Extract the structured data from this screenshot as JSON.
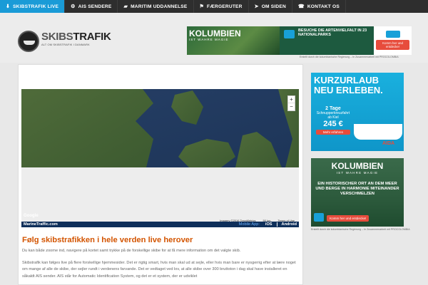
{
  "nav": {
    "items": [
      {
        "label": "SKIBSTRAFIK LIVE",
        "icon": "download-icon",
        "glyph": "⬇"
      },
      {
        "label": "AIS SENDERE",
        "icon": "gear-icon",
        "glyph": "⚙"
      },
      {
        "label": "MARITIM UDDANNELSE",
        "icon": "graduation-icon",
        "glyph": "▰"
      },
      {
        "label": "FÆRGERUTER",
        "icon": "flag-icon",
        "glyph": "⚑"
      },
      {
        "label": "OM SIDEN",
        "icon": "paper-plane-icon",
        "glyph": "➤"
      },
      {
        "label": "KONTAKT OS",
        "icon": "phone-icon",
        "glyph": "☎"
      }
    ]
  },
  "logo": {
    "main_a": "SKIBS",
    "main_b": "TRAFIK",
    "tagline": "ALT OM SKIBSTRAFIK I DANMARK"
  },
  "ad_top": {
    "headline": "KOLUMBIEN",
    "sub": "IST WAHRE MAGIE",
    "mid": "BESUCHE DIE ARTENVIELFALT IN 23 NATIONALPARKS",
    "cta": "Komm her und entdecke!",
    "credit": "Erstellt durch die kolumbianische Regierung – In Zusammenarbeit mit PROCOLOMBIA"
  },
  "map": {
    "zoom_in": "+",
    "zoom_out": "−",
    "google": "Google",
    "attribution": "Imagery ©2016 TerraMetrics",
    "scale": "50 km",
    "terms": "Terms of Use"
  },
  "marinetraffic": {
    "brand": "MarineTraffic.com",
    "mobile": "Mobile App:",
    "ios": "iOS",
    "android": "Android"
  },
  "content": {
    "title": "Følg skibstrafikken i hele verden live herover",
    "lead": "Du kan både zoome ind, navigere på kortet samt trykke på de forskellige skibe for at få mere information om det valgte skib.",
    "body": "Skibstrafik kan følges live på flere forskellige hjemmesider. Det er rigtig smart, hvis man skal ud at sejle, eller hvis man bare er nysgerrig efter at lære noget om mange af alle de skibe, der sejler rundt i verdenens farvande. Det er vedtaget ved lov, at alle skibe over 300 bruttoton i dag skal have installeret en såkaldt AIS sender. AIS står for Automatic Identification System, og det er et system, der er udviklet"
  },
  "side_ad1": {
    "headline": "KURZURLAUB NEU ERLEBEN.",
    "days": "2 Tage",
    "trip": "Schnupperkreuzfahrt ab Kiel",
    "price": "245 €",
    "cta": "Mehr erfahren",
    "brand": "AIDA"
  },
  "side_ad2": {
    "headline": "KOLUMBIEN",
    "sub": "IST WAHRE MAGIE",
    "text": "EIN HISTORISCHER ORT AN DEM MEER UND BERGE IN HARMONIE MITEINANDER VERSCHMELZEN",
    "cta": "Komm her und entdecke!",
    "credit": "Erstellt durch die kolumbianische Regierung – In Zusammenarbeit mit PROCOLOMBIA"
  }
}
